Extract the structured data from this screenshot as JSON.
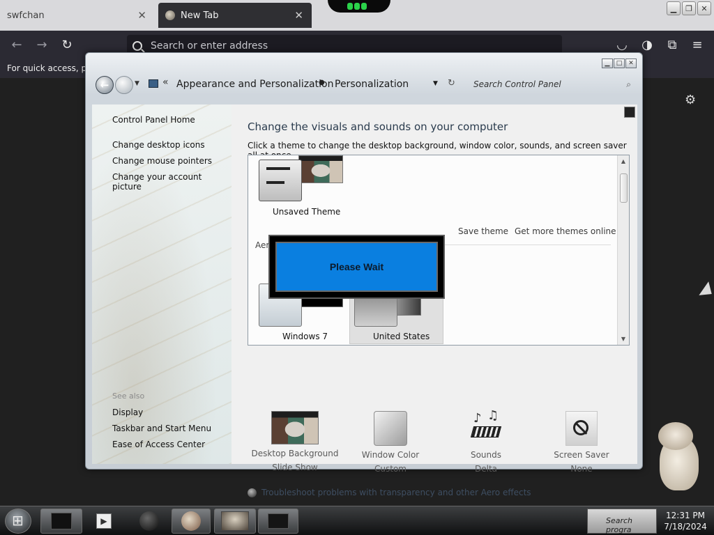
{
  "browser": {
    "tabs": [
      {
        "label": "swfchan"
      },
      {
        "label": "New Tab"
      }
    ],
    "address_placeholder": "Search or enter address",
    "bookmarks_hint": "For quick access, plac"
  },
  "window": {
    "breadcrumb": [
      "Appearance and Personalization",
      "Personalization"
    ],
    "search_placeholder": "Search Control Panel"
  },
  "sidebar": {
    "links": [
      "Control Panel Home",
      "Change desktop icons",
      "Change mouse pointers",
      "Change your account picture"
    ],
    "see_also_label": "See also",
    "see_also_links": [
      "Display",
      "Taskbar and Start Menu",
      "Ease of Access Center"
    ]
  },
  "main": {
    "title": "Change the visuals and sounds on your computer",
    "subtitle": "Click a theme to change the desktop background, window color, sounds, and screen saver all at once.",
    "themes": {
      "unsaved_label": "Unsaved Theme",
      "save_link": "Save theme",
      "more_link": "Get more themes online",
      "aero_partial": "Aero",
      "items": [
        "Windows 7",
        "United States"
      ]
    },
    "overlay_text": "Please Wait",
    "tiles": [
      {
        "label": "Desktop Background",
        "value": "Slide Show"
      },
      {
        "label": "Window Color",
        "value": "Custom"
      },
      {
        "label": "Sounds",
        "value": "Delta"
      },
      {
        "label": "Screen Saver",
        "value": "None"
      }
    ],
    "troubleshoot": "Troubleshoot problems with transparency and other Aero effects"
  },
  "taskbar": {
    "tray_search": "Search progra",
    "time": "12:31 PM",
    "date": "7/18/2024"
  }
}
